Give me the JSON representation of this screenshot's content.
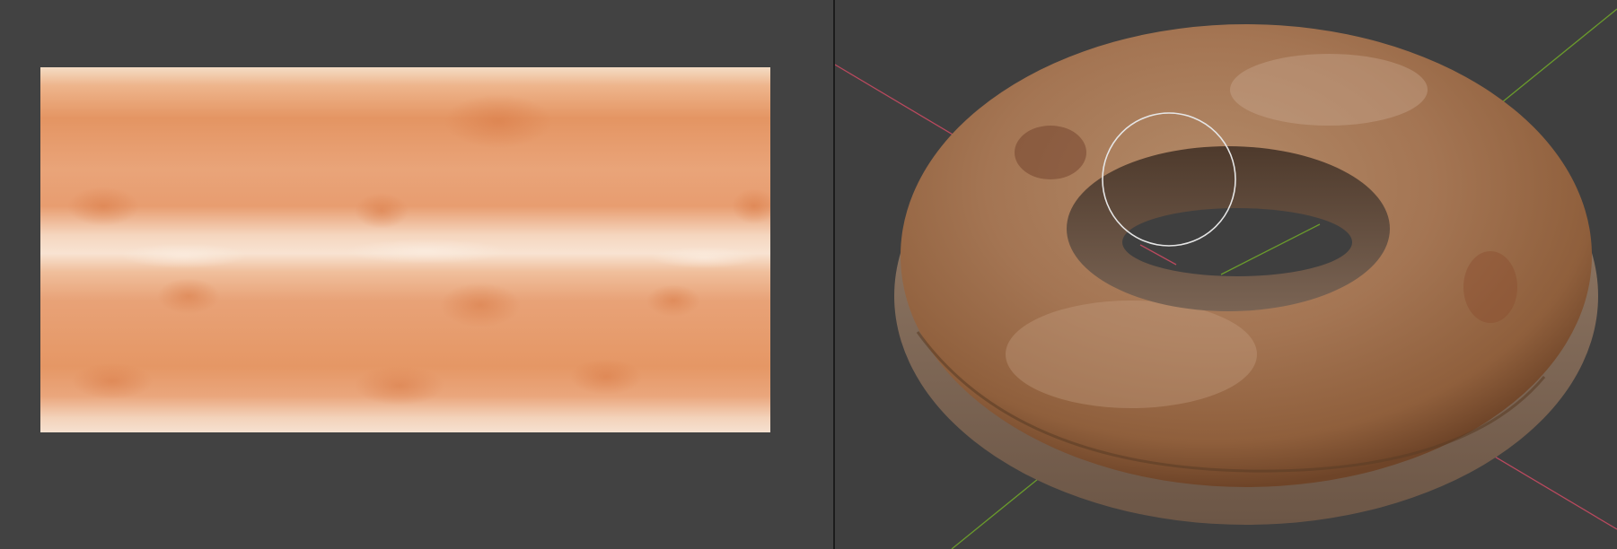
{
  "editors": {
    "image_editor": {
      "texture": {
        "base_color": "#e8a57a",
        "stripe_color": "#dd8a58",
        "highlight_color": "#f7e6d6"
      }
    },
    "viewport": {
      "axis_colors": {
        "x": "#b9495e",
        "y": "#6a9a2c"
      },
      "brush_circle_color": "#e6e6e6",
      "mesh_colors": {
        "donut_base": "#a06b42",
        "donut_highlight": "#c9a487",
        "icing_edge": "#b79a82"
      }
    }
  }
}
